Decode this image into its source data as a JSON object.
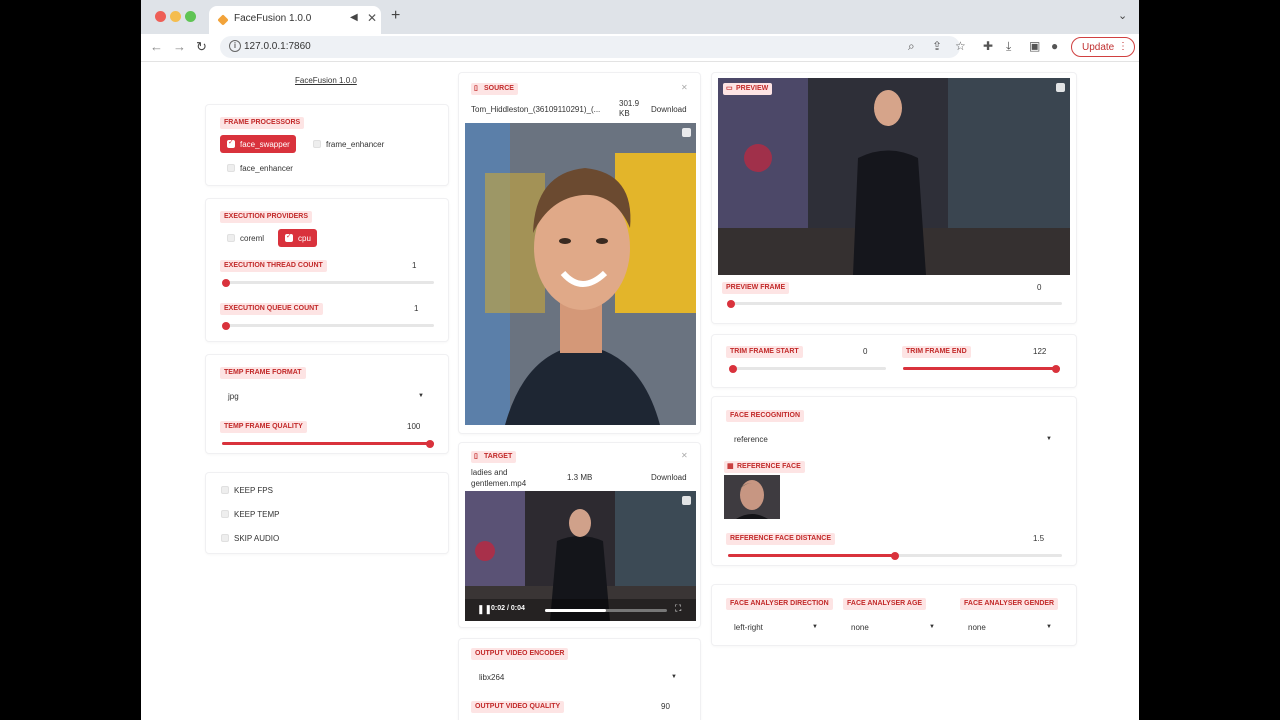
{
  "browser": {
    "tab_title": "FaceFusion 1.0.0",
    "url": "127.0.0.1:7860",
    "update_label": "Update"
  },
  "app": {
    "title": "FaceFusion 1.0.0"
  },
  "left": {
    "frame_processors": {
      "label": "FRAME PROCESSORS",
      "options": [
        "face_swapper",
        "frame_enhancer",
        "face_enhancer"
      ],
      "selected": [
        "face_swapper"
      ]
    },
    "execution_providers": {
      "label": "EXECUTION PROVIDERS",
      "options": [
        "coreml",
        "cpu"
      ],
      "selected": [
        "cpu"
      ]
    },
    "thread_count": {
      "label": "EXECUTION THREAD COUNT",
      "value": "1",
      "fraction": 0.0
    },
    "queue_count": {
      "label": "EXECUTION QUEUE COUNT",
      "value": "1",
      "fraction": 0.0
    },
    "temp_frame_format": {
      "label": "TEMP FRAME FORMAT",
      "value": "jpg"
    },
    "temp_frame_quality": {
      "label": "TEMP FRAME QUALITY",
      "value": "100",
      "fraction": 1.0
    },
    "options": [
      "KEEP FPS",
      "KEEP TEMP",
      "SKIP AUDIO"
    ]
  },
  "middle": {
    "source": {
      "label": "SOURCE",
      "filename": "Tom_Hiddleston_(36109110291)_(...",
      "size": "301.9 KB",
      "download": "Download"
    },
    "target": {
      "label": "TARGET",
      "filename": "ladies and gentlemen.mp4",
      "size": "1.3 MB",
      "download": "Download",
      "time": "0:02 / 0:04",
      "progress": 0.5
    },
    "output_video_encoder": {
      "label": "OUTPUT VIDEO ENCODER",
      "value": "libx264"
    },
    "output_video_quality": {
      "label": "OUTPUT VIDEO QUALITY",
      "value": "90"
    }
  },
  "right": {
    "preview": {
      "label": "PREVIEW"
    },
    "preview_frame": {
      "label": "PREVIEW FRAME",
      "value": "0",
      "fraction": 0.0
    },
    "trim_start": {
      "label": "TRIM FRAME START",
      "value": "0",
      "fraction": 0.0
    },
    "trim_end": {
      "label": "TRIM FRAME END",
      "value": "122",
      "fraction": 1.0
    },
    "face_recognition": {
      "label": "FACE RECOGNITION",
      "value": "reference"
    },
    "reference_face": {
      "label": "REFERENCE FACE"
    },
    "reference_face_distance": {
      "label": "REFERENCE FACE DISTANCE",
      "value": "1.5",
      "fraction": 0.5
    },
    "face_analyser_direction": {
      "label": "FACE ANALYSER DIRECTION",
      "value": "left-right"
    },
    "face_analyser_age": {
      "label": "FACE ANALYSER AGE",
      "value": "none"
    },
    "face_analyser_gender": {
      "label": "FACE ANALYSER GENDER",
      "value": "none"
    }
  },
  "colors": {
    "accent": "#d9323c",
    "badge_bg": "#fde4e4",
    "badge_text": "#c22a2a"
  }
}
